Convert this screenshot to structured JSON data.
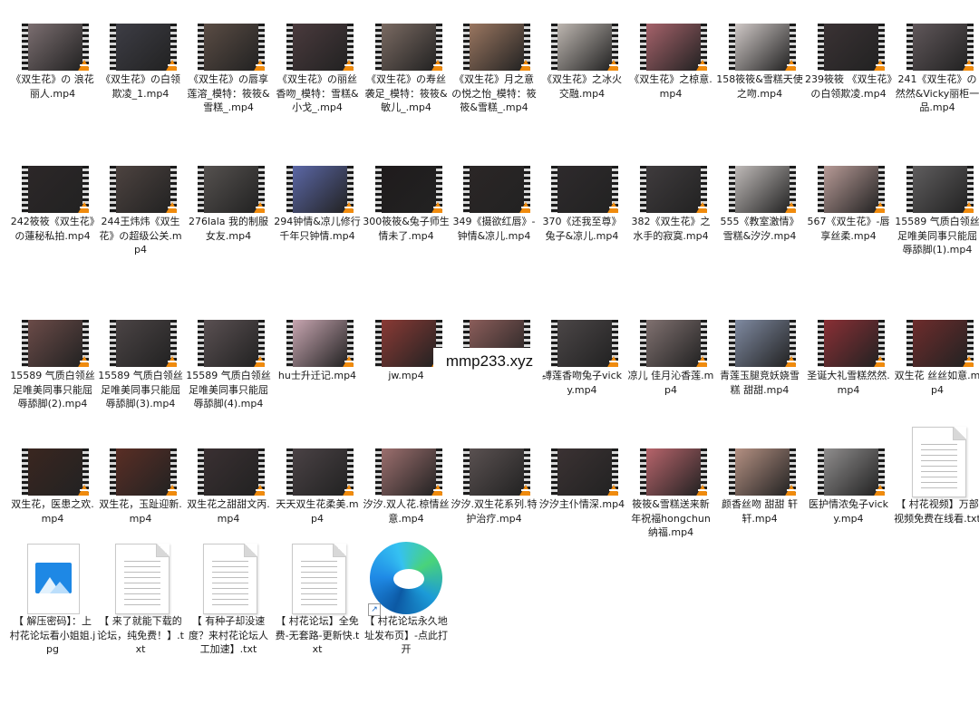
{
  "folder": {
    "items": [
      {
        "type": "video",
        "label": "《双生花》の 浪花丽人.mp4",
        "tone": "#7b6e70"
      },
      {
        "type": "video",
        "label": "《双生花》の白领欺凌_1.mp4",
        "tone": "#3d3d45"
      },
      {
        "type": "video",
        "label": "《双生花》の唇享莲溶_模特：筱筱&雪糕_.mp4",
        "tone": "#5a4c44"
      },
      {
        "type": "video",
        "label": "《双生花》の丽丝香吻_模特：雪糕&小戈_.mp4",
        "tone": "#4a3a3d"
      },
      {
        "type": "video",
        "label": "《双生花》の寿丝袭足_模特：筱筱&敏儿_.mp4",
        "tone": "#7a6a62"
      },
      {
        "type": "video",
        "label": "《双生花》月之意の悦之怡_模特：筱筱&雪糕_.mp4",
        "tone": "#9a7660"
      },
      {
        "type": "video",
        "label": "《双生花》之冰火交融.mp4",
        "tone": "#bdb6b0"
      },
      {
        "type": "video",
        "label": "《双生花》之椋意.mp4",
        "tone": "#a5626a"
      },
      {
        "type": "video",
        "label": "158筱筱&雪糕天使之吻.mp4",
        "tone": "#cfc8c6"
      },
      {
        "type": "video",
        "label": "239筱筱 《双生花》の白领欺凌.mp4",
        "tone": "#3a3234"
      },
      {
        "type": "video",
        "label": "241《双生花》の 然然&Vicky丽柜一品.mp4",
        "tone": "#60575a"
      },
      {
        "type": "video",
        "label": "242筱筱《双生花》の蓮秘私拍.mp4",
        "tone": "#2c2728"
      },
      {
        "type": "video",
        "label": "244王炜炜《双生花》の超级公关.mp4",
        "tone": "#4d4340"
      },
      {
        "type": "video",
        "label": "276lala 我的制服女友.mp4",
        "tone": "#55514f"
      },
      {
        "type": "video",
        "label": "294钟情&凉儿修行千年只钟情.mp4",
        "tone": "#5b67a6"
      },
      {
        "type": "video",
        "label": "300筱筱&兔子师生情未了.mp4",
        "tone": "#1f1b1c"
      },
      {
        "type": "video",
        "label": "349《摄欲红唇》-钟情&凉儿.mp4",
        "tone": "#2b2626"
      },
      {
        "type": "video",
        "label": "370《还我至尊》兔子&凉儿.mp4",
        "tone": "#2e2a2c"
      },
      {
        "type": "video",
        "label": "382《双生花》之水手的寂寞.mp4",
        "tone": "#3f3b3d"
      },
      {
        "type": "video",
        "label": "555《教室激情》雪糕&汐汐.mp4",
        "tone": "#bfbab8"
      },
      {
        "type": "video",
        "label": "567《双生花》-唇享丝柔.mp4",
        "tone": "#b79a96"
      },
      {
        "type": "video",
        "label": "15589 气质白领丝足唯美同事只能屈辱舔脚(1).mp4",
        "tone": "#5f5d5e"
      },
      {
        "type": "video",
        "label": "15589 气质白领丝足唯美同事只能屈辱舔脚(2).mp4",
        "tone": "#6b4b48"
      },
      {
        "type": "video",
        "label": "15589 气质白领丝足唯美同事只能屈辱舔脚(3).mp4",
        "tone": "#4b4445"
      },
      {
        "type": "video",
        "label": "15589 气质白领丝足唯美同事只能屈辱舔脚(4).mp4",
        "tone": "#5a5052"
      },
      {
        "type": "video",
        "label": "hu士升迁记.mp4",
        "tone": "#c7a5b0"
      },
      {
        "type": "video",
        "label": "jw.mp4",
        "tone": "#8a3a35"
      },
      {
        "type": "video",
        "label": "",
        "tone": "#8b5d5a"
      },
      {
        "type": "video",
        "label": "缚莲香吻兔子vicky.mp4",
        "tone": "#4b4647"
      },
      {
        "type": "video",
        "label": "凉儿 佳月沁香莲.mp4",
        "tone": "#807170"
      },
      {
        "type": "video",
        "label": "青莲玉腿竞妖娆雪糕 甜甜.mp4",
        "tone": "#7f8aa1"
      },
      {
        "type": "video",
        "label": "圣诞大礼雪糕然然.mp4",
        "tone": "#8a2f35"
      },
      {
        "type": "video",
        "label": "双生花 丝丝如意.mp4",
        "tone": "#6e2c2c"
      },
      {
        "type": "video",
        "label": "双生花，医患之欢.mp4",
        "tone": "#3a2620"
      },
      {
        "type": "video",
        "label": "双生花，玉趾迎新.mp4",
        "tone": "#5a2e25"
      },
      {
        "type": "video",
        "label": "双生花之甜甜文丙.mp4",
        "tone": "#3a3032"
      },
      {
        "type": "video",
        "label": "天天双生花柔美.mp4",
        "tone": "#4a4245"
      },
      {
        "type": "video",
        "label": "汐汐.双人花.椋情丝意.mp4",
        "tone": "#9c6f6e"
      },
      {
        "type": "video",
        "label": "汐汐.双生花系列.特护治疗.mp4",
        "tone": "#5a5151"
      },
      {
        "type": "video",
        "label": "汐汐主仆情深.mp4",
        "tone": "#3b3233"
      },
      {
        "type": "video",
        "label": "筱筱&雪糕送来新年祝福hongchun纳福.mp4",
        "tone": "#b7646b"
      },
      {
        "type": "video",
        "label": "颜香丝吻 甜甜 轩轩.mp4",
        "tone": "#b49082"
      },
      {
        "type": "video",
        "label": "医护情浓兔子vicky.mp4",
        "tone": "#8f8d8d"
      },
      {
        "type": "txt",
        "label": "【 村花视频】万部视频免费在线看.txt"
      },
      {
        "type": "jpg",
        "label": "【 解压密码】：上村花论坛看小姐姐.jpg"
      },
      {
        "type": "txt",
        "label": "【 来了就能下载的论坛，纯免费！】.txt"
      },
      {
        "type": "txt",
        "label": "【 有种子却没速度？来村花论坛人工加速】.txt"
      },
      {
        "type": "txt",
        "label": "【 村花论坛】全免费-无套路-更新快.txt"
      },
      {
        "type": "link",
        "label": "【 村花论坛永久地址发布页】-点此打开"
      }
    ]
  },
  "watermark": {
    "text": "mmp233.xyz"
  }
}
